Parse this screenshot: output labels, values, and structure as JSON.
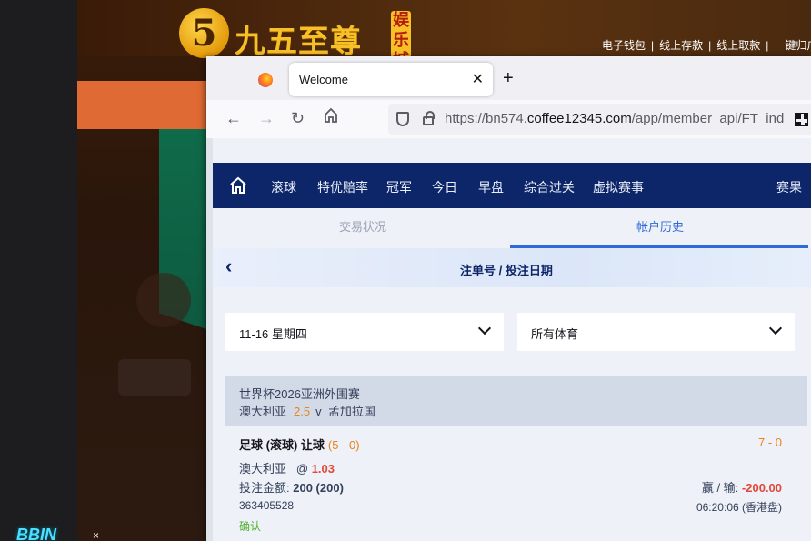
{
  "background_site": {
    "logo_mark": "5",
    "logo_text": "九五至尊",
    "logo_badge": "娱乐城",
    "top_links": [
      "电子钱包",
      "线上存款",
      "线上取款",
      "一键归户"
    ],
    "bbin_logo": "BBIN",
    "bbin_close": "×"
  },
  "browser": {
    "tab_title": "Welcome",
    "tab_close": "✕",
    "new_tab": "+",
    "url_prefix": "https://bn574.",
    "url_domain": "coffee12345.com",
    "url_path": "/app/member_api/FT_ind"
  },
  "main_nav": {
    "items": [
      "滚球",
      "特优赔率",
      "冠军",
      "今日",
      "早盘",
      "综合过关",
      "虚拟赛事",
      "赛果"
    ]
  },
  "sub_tabs": {
    "inactive": "交易状况",
    "active": "帐户历史"
  },
  "title_bar": {
    "back": "‹",
    "title": "注单号 / 投注日期"
  },
  "filters": {
    "date": "11-16 星期四",
    "sport": "所有体育"
  },
  "match": {
    "league": "世界杯2026亚洲外围赛",
    "home": "澳大利亚",
    "handicap": "2.5",
    "vs": "v",
    "away": "孟加拉国"
  },
  "bet": {
    "type": "足球 (滚球) 让球",
    "score_at_bet": "(5 - 0)",
    "final_score": "7 - 0",
    "selection": "澳大利亚",
    "odds_prefix": "@",
    "odds": "1.03",
    "stake_label": "投注金额:",
    "stake": "200 (200)",
    "winloss_label": "赢 / 输:",
    "winloss": "-200.00",
    "ticket_no": "363405528",
    "time": "06:20:06 (香港盘)",
    "status": "确认"
  },
  "colors": {
    "nav_bg": "#0d2669",
    "accent_blue": "#2e6bd9",
    "orange": "#e8841a",
    "loss_red": "#e0483a",
    "confirmed_green": "#4caf2a"
  }
}
